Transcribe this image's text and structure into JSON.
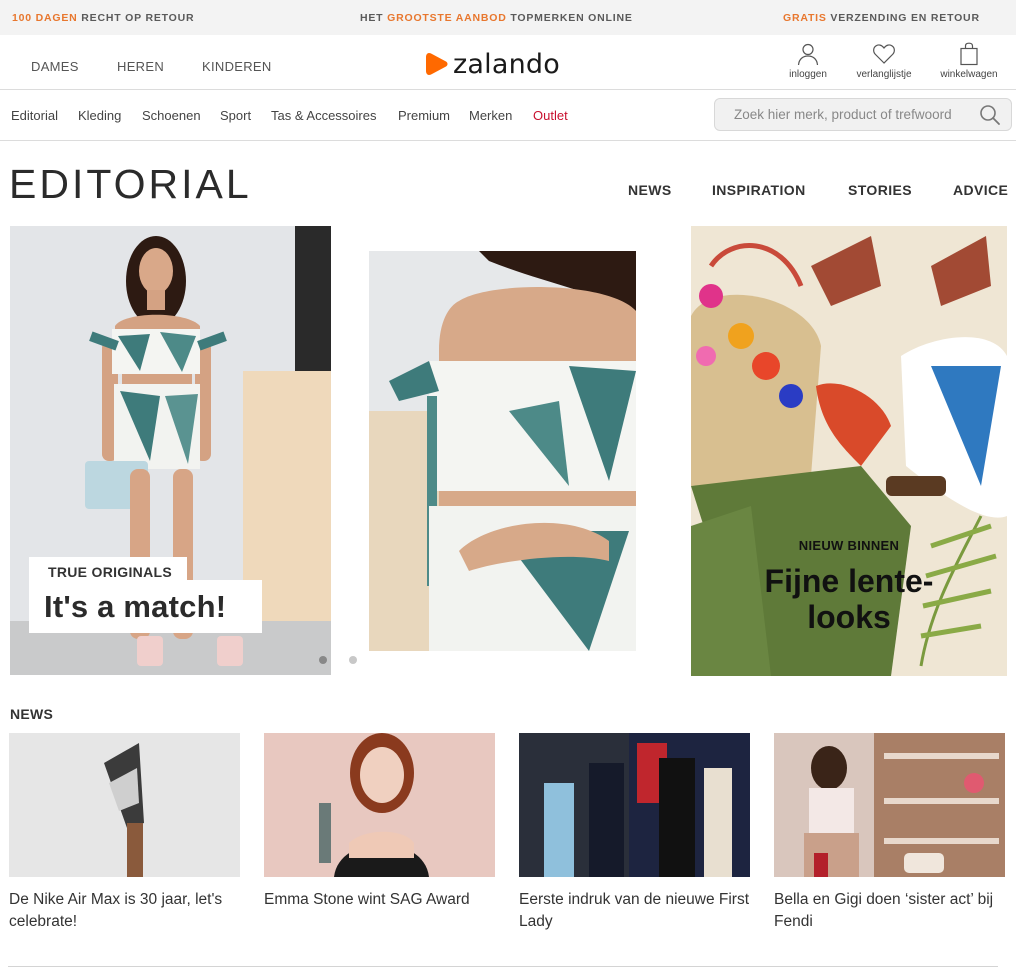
{
  "usp_bar": {
    "items": [
      {
        "accent": "100 DAGEN",
        "rest": " RECHT OP RETOUR"
      },
      {
        "pre": "HET ",
        "accent": "GROOTSTE AANBOD",
        "rest": " TOPMERKEN ONLINE"
      },
      {
        "accent": "GRATIS",
        "rest": " VERZENDING EN RETOUR"
      }
    ],
    "accent_color": "#e8772e"
  },
  "header": {
    "gender_nav": [
      "DAMES",
      "HEREN",
      "KINDEREN"
    ],
    "logo": {
      "text": "zalando",
      "icon": "zalando-play-icon",
      "color": "#ff6900"
    },
    "actions": [
      {
        "label": "inloggen",
        "icon": "user-icon"
      },
      {
        "label": "verlanglijstje",
        "icon": "heart-icon"
      },
      {
        "label": "winkelwagen",
        "icon": "shopping-bag-icon"
      }
    ]
  },
  "category_nav": {
    "items": [
      "Editorial",
      "Kleding",
      "Schoenen",
      "Sport",
      "Tas & Accessoires",
      "Premium",
      "Merken",
      "Outlet"
    ],
    "highlight_color": "#c8102e",
    "search": {
      "placeholder": "Zoek hier merk, product of trefwoord",
      "value": "",
      "icon": "search-icon"
    }
  },
  "editorial": {
    "title": "EDITORIAL",
    "tabs": [
      "NEWS",
      "INSPIRATION",
      "STORIES",
      "ADVICE"
    ]
  },
  "hero": {
    "slide_1": {
      "kicker": "TRUE ORIGINALS",
      "title": "It's a match!"
    },
    "carousel": {
      "total": 2,
      "active": 1
    },
    "slide_3": {
      "kicker": "NIEUW BINNEN",
      "title": "Fijne lente-looks",
      "title_line1": "Fijne lente-",
      "title_line2": "looks"
    }
  },
  "news": {
    "heading": "NEWS",
    "items": [
      {
        "caption": "De Nike Air Max is 30 jaar, let's celebrate!"
      },
      {
        "caption": "Emma Stone wint SAG Award"
      },
      {
        "caption": "Eerste indruk van de nieuwe First Lady"
      },
      {
        "caption": "Bella en Gigi doen ‘sister act’ bij Fendi"
      }
    ]
  }
}
